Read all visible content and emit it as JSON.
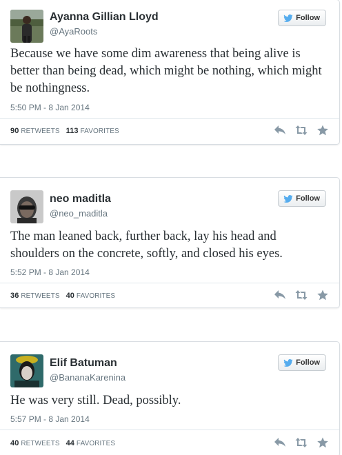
{
  "follow_label": "Follow",
  "retweets_label": "RETWEETS",
  "favorites_label": "FAVORITES",
  "colors": {
    "twitter_blue": "#55acee",
    "icon_gray": "#8899a6",
    "text": "#292f33",
    "muted": "#66757f"
  },
  "tweets": [
    {
      "name": "Ayanna Gillian Lloyd",
      "handle": "@AyaRoots",
      "text": "Because we have some dim awareness that being alive is better than being dead, which might be nothing, which might be nothingness.",
      "timestamp": "5:50 PM - 8 Jan 2014",
      "retweets": "90",
      "favorites": "113"
    },
    {
      "name": "neo maditla",
      "handle": "@neo_maditla",
      "text": "The man leaned back, further back, lay his head and shoulders on the concrete, softly, and closed his eyes.",
      "timestamp": "5:52 PM - 8 Jan 2014",
      "retweets": "36",
      "favorites": "40"
    },
    {
      "name": "Elif Batuman",
      "handle": "@BananaKarenina",
      "text": "He was very still. Dead, possibly.",
      "timestamp": "5:57 PM - 8 Jan 2014",
      "retweets": "40",
      "favorites": "44"
    }
  ]
}
